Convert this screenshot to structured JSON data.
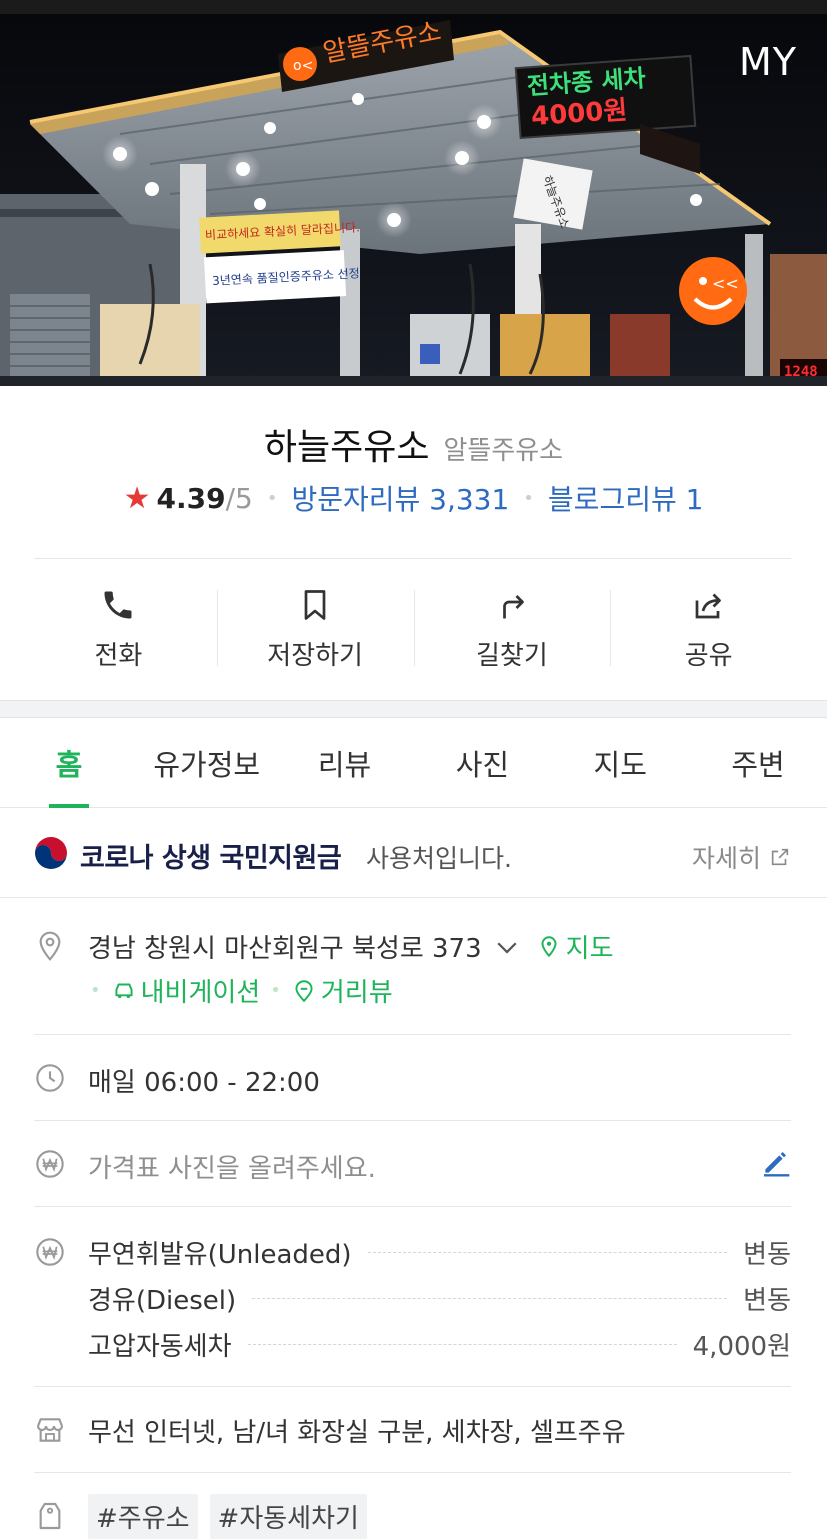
{
  "hero": {
    "my_label": "MY",
    "sign_brand": "알뜰주유소",
    "sign_wash_line1": "전차종 세차",
    "sign_wash_line2": "4000원",
    "sign_banner1": "비교하세요 확실히 달라집니다.",
    "sign_banner2": "3년연속 품질인증주유소 선정",
    "sign_pole": "하늘주유소",
    "sign_price_digits": "1248"
  },
  "place": {
    "name": "하늘주유소",
    "category": "알뜰주유소",
    "rating": "4.39",
    "rating_max": "/5",
    "visitor_reviews": "방문자리뷰 3,331",
    "blog_reviews": "블로그리뷰 1"
  },
  "actions": [
    {
      "label": "전화",
      "icon": "phone-icon"
    },
    {
      "label": "저장하기",
      "icon": "bookmark-icon"
    },
    {
      "label": "길찾기",
      "icon": "directions-icon"
    },
    {
      "label": "공유",
      "icon": "share-icon"
    }
  ],
  "tabs": [
    {
      "label": "홈",
      "active": true
    },
    {
      "label": "유가정보",
      "active": false
    },
    {
      "label": "리뷰",
      "active": false
    },
    {
      "label": "사진",
      "active": false
    },
    {
      "label": "지도",
      "active": false
    },
    {
      "label": "주변",
      "active": false
    }
  ],
  "support": {
    "title": "코로나 상생 국민지원금",
    "suffix": "사용처입니다.",
    "more": "자세히"
  },
  "address": {
    "text": "경남 창원시 마산회원구 북성로 373",
    "map_link": "지도",
    "navigation_link": "내비게이션",
    "streetview_link": "거리뷰"
  },
  "hours": {
    "text": "매일 06:00 - 22:00"
  },
  "price_photo": {
    "prompt": "가격표 사진을 올려주세요."
  },
  "prices": [
    {
      "name": "무연휘발유(Unleaded)",
      "value": "변동"
    },
    {
      "name": "경유(Diesel)",
      "value": "변동"
    },
    {
      "name": "고압자동세차",
      "value": "4,000원"
    }
  ],
  "amenities": {
    "text": "무선 인터넷, 남/녀 화장실 구분, 세차장, 셀프주유"
  },
  "tags": [
    "#주유소",
    "#자동세차기"
  ],
  "colors": {
    "accent_green": "#1eb45a",
    "link_blue": "#2e6bc0",
    "star_red": "#e53935",
    "brand_orange": "#ff6a13"
  }
}
